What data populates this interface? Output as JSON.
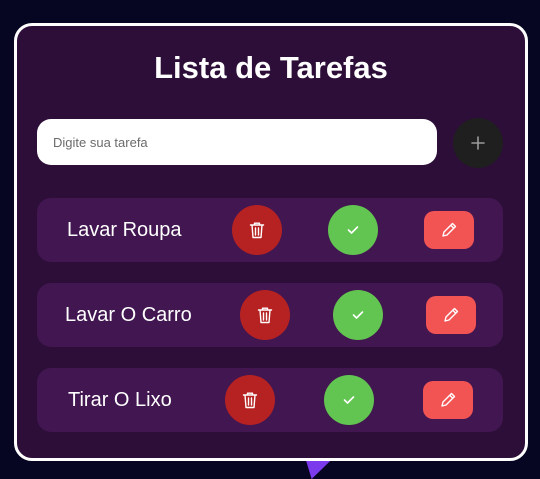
{
  "app": {
    "title": "Lista de Tarefas"
  },
  "input": {
    "placeholder": "Digite sua tarefa",
    "value": ""
  },
  "add_button": {
    "icon": "plus-icon"
  },
  "tasks": [
    {
      "label": "Lavar Roupa"
    },
    {
      "label": "Lavar O Carro"
    },
    {
      "label": "Tirar O Lixo"
    }
  ],
  "colors": {
    "background": "#070622",
    "card": "#2c0e38",
    "task_row": "#421651",
    "delete": "#b62222",
    "done": "#62c451",
    "edit": "#f25454",
    "add": "#1f1f1f"
  }
}
